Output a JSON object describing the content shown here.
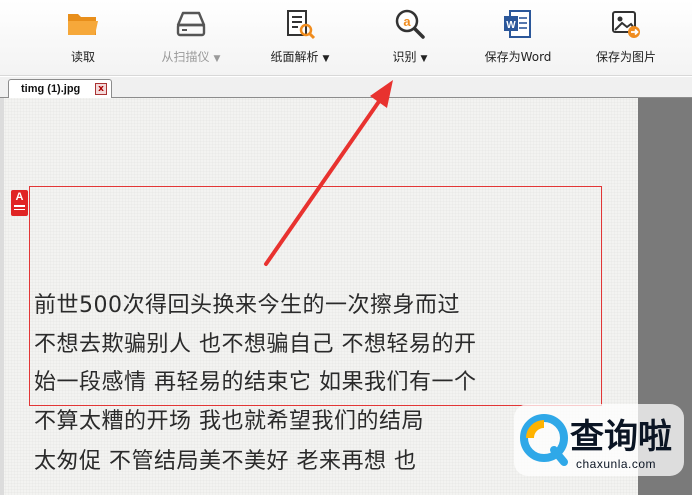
{
  "toolbar": {
    "items": [
      {
        "label": "读取",
        "icon": "folder-icon",
        "dropdown": false,
        "disabled": false
      },
      {
        "label": "从扫描仪",
        "icon": "scanner-icon",
        "dropdown": true,
        "disabled": true
      },
      {
        "label": "纸面解析",
        "icon": "page-analysis-icon",
        "dropdown": true,
        "disabled": false
      },
      {
        "label": "识别",
        "icon": "recognize-icon",
        "dropdown": true,
        "disabled": false
      },
      {
        "label": "保存为Word",
        "icon": "word-icon",
        "dropdown": false,
        "disabled": false
      },
      {
        "label": "保存为图片",
        "icon": "save-image-icon",
        "dropdown": false,
        "disabled": false
      }
    ],
    "caret": "▼"
  },
  "tab": {
    "title": "timg (1).jpg",
    "close": "x"
  },
  "document": {
    "marker": "A",
    "lines": [
      "前世500次得回头换来今生的一次擦身而过",
      " 不想去欺骗别人 也不想骗自己 不想轻易的开",
      "始一段感情 再轻易的结束它 如果我们有一个",
      "不算太糟的开场 我也就希望我们的结局",
      "太匆促 不管结局美不美好 老来再想 也"
    ]
  },
  "watermark": {
    "text": "查询啦",
    "url": "chaxunla.com"
  },
  "colors": {
    "accent_orange": "#f08c1e",
    "highlight_red": "#e23636",
    "arrow_red": "#e8322f"
  }
}
